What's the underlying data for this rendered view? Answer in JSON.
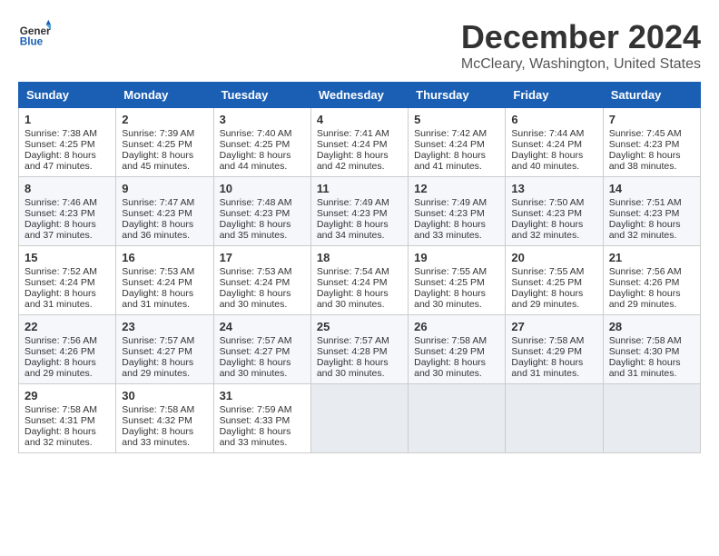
{
  "logo": {
    "line1": "General",
    "line2": "Blue"
  },
  "title": "December 2024",
  "subtitle": "McCleary, Washington, United States",
  "days_of_week": [
    "Sunday",
    "Monday",
    "Tuesday",
    "Wednesday",
    "Thursday",
    "Friday",
    "Saturday"
  ],
  "weeks": [
    [
      {
        "day": 1,
        "sunrise": "7:38 AM",
        "sunset": "4:25 PM",
        "daylight": "8 hours and 47 minutes."
      },
      {
        "day": 2,
        "sunrise": "7:39 AM",
        "sunset": "4:25 PM",
        "daylight": "8 hours and 45 minutes."
      },
      {
        "day": 3,
        "sunrise": "7:40 AM",
        "sunset": "4:25 PM",
        "daylight": "8 hours and 44 minutes."
      },
      {
        "day": 4,
        "sunrise": "7:41 AM",
        "sunset": "4:24 PM",
        "daylight": "8 hours and 42 minutes."
      },
      {
        "day": 5,
        "sunrise": "7:42 AM",
        "sunset": "4:24 PM",
        "daylight": "8 hours and 41 minutes."
      },
      {
        "day": 6,
        "sunrise": "7:44 AM",
        "sunset": "4:24 PM",
        "daylight": "8 hours and 40 minutes."
      },
      {
        "day": 7,
        "sunrise": "7:45 AM",
        "sunset": "4:23 PM",
        "daylight": "8 hours and 38 minutes."
      }
    ],
    [
      {
        "day": 8,
        "sunrise": "7:46 AM",
        "sunset": "4:23 PM",
        "daylight": "8 hours and 37 minutes."
      },
      {
        "day": 9,
        "sunrise": "7:47 AM",
        "sunset": "4:23 PM",
        "daylight": "8 hours and 36 minutes."
      },
      {
        "day": 10,
        "sunrise": "7:48 AM",
        "sunset": "4:23 PM",
        "daylight": "8 hours and 35 minutes."
      },
      {
        "day": 11,
        "sunrise": "7:49 AM",
        "sunset": "4:23 PM",
        "daylight": "8 hours and 34 minutes."
      },
      {
        "day": 12,
        "sunrise": "7:49 AM",
        "sunset": "4:23 PM",
        "daylight": "8 hours and 33 minutes."
      },
      {
        "day": 13,
        "sunrise": "7:50 AM",
        "sunset": "4:23 PM",
        "daylight": "8 hours and 32 minutes."
      },
      {
        "day": 14,
        "sunrise": "7:51 AM",
        "sunset": "4:23 PM",
        "daylight": "8 hours and 32 minutes."
      }
    ],
    [
      {
        "day": 15,
        "sunrise": "7:52 AM",
        "sunset": "4:24 PM",
        "daylight": "8 hours and 31 minutes."
      },
      {
        "day": 16,
        "sunrise": "7:53 AM",
        "sunset": "4:24 PM",
        "daylight": "8 hours and 31 minutes."
      },
      {
        "day": 17,
        "sunrise": "7:53 AM",
        "sunset": "4:24 PM",
        "daylight": "8 hours and 30 minutes."
      },
      {
        "day": 18,
        "sunrise": "7:54 AM",
        "sunset": "4:24 PM",
        "daylight": "8 hours and 30 minutes."
      },
      {
        "day": 19,
        "sunrise": "7:55 AM",
        "sunset": "4:25 PM",
        "daylight": "8 hours and 30 minutes."
      },
      {
        "day": 20,
        "sunrise": "7:55 AM",
        "sunset": "4:25 PM",
        "daylight": "8 hours and 29 minutes."
      },
      {
        "day": 21,
        "sunrise": "7:56 AM",
        "sunset": "4:26 PM",
        "daylight": "8 hours and 29 minutes."
      }
    ],
    [
      {
        "day": 22,
        "sunrise": "7:56 AM",
        "sunset": "4:26 PM",
        "daylight": "8 hours and 29 minutes."
      },
      {
        "day": 23,
        "sunrise": "7:57 AM",
        "sunset": "4:27 PM",
        "daylight": "8 hours and 29 minutes."
      },
      {
        "day": 24,
        "sunrise": "7:57 AM",
        "sunset": "4:27 PM",
        "daylight": "8 hours and 30 minutes."
      },
      {
        "day": 25,
        "sunrise": "7:57 AM",
        "sunset": "4:28 PM",
        "daylight": "8 hours and 30 minutes."
      },
      {
        "day": 26,
        "sunrise": "7:58 AM",
        "sunset": "4:29 PM",
        "daylight": "8 hours and 30 minutes."
      },
      {
        "day": 27,
        "sunrise": "7:58 AM",
        "sunset": "4:29 PM",
        "daylight": "8 hours and 31 minutes."
      },
      {
        "day": 28,
        "sunrise": "7:58 AM",
        "sunset": "4:30 PM",
        "daylight": "8 hours and 31 minutes."
      }
    ],
    [
      {
        "day": 29,
        "sunrise": "7:58 AM",
        "sunset": "4:31 PM",
        "daylight": "8 hours and 32 minutes."
      },
      {
        "day": 30,
        "sunrise": "7:58 AM",
        "sunset": "4:32 PM",
        "daylight": "8 hours and 33 minutes."
      },
      {
        "day": 31,
        "sunrise": "7:59 AM",
        "sunset": "4:33 PM",
        "daylight": "8 hours and 33 minutes."
      },
      null,
      null,
      null,
      null
    ]
  ]
}
